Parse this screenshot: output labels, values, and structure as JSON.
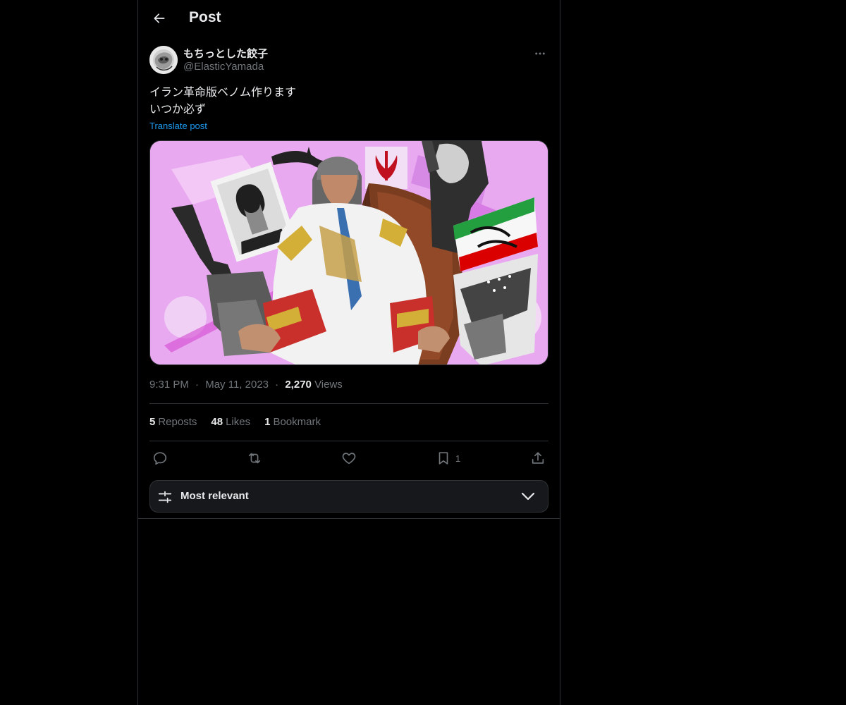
{
  "header": {
    "title": "Post",
    "back_icon": "arrow-left-icon"
  },
  "author": {
    "display_name": "もちっとした餃子",
    "handle": "@ElasticYamada"
  },
  "post": {
    "text_lines": [
      "イラン革命版ベノム作ります",
      "いつか必ず"
    ],
    "translate_label": "Translate post",
    "time": "9:31 PM",
    "date": "May 11, 2023",
    "views_count": "2,270",
    "views_label": "Views",
    "separator": "·"
  },
  "stats": {
    "reposts_count": "5",
    "reposts_label": "Reposts",
    "likes_count": "48",
    "likes_label": "Likes",
    "bookmarks_count": "1",
    "bookmarks_label": "Bookmark"
  },
  "actions": {
    "bookmark_count": "1"
  },
  "sort": {
    "label": "Most relevant"
  },
  "colors": {
    "background": "#000000",
    "text": "#e7e9ea",
    "muted": "#71767b",
    "accent": "#1d9bf0",
    "border": "#2f3336"
  }
}
